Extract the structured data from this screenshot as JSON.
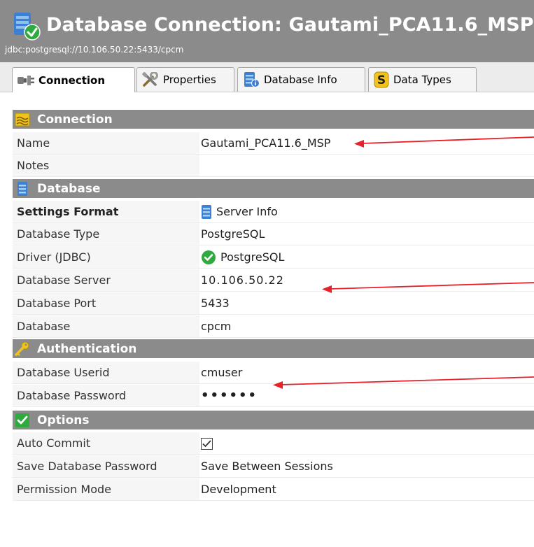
{
  "header": {
    "title": "Database Connection: Gautami_PCA11.6_MSP",
    "url": "jdbc:postgresql://10.106.50.22:5433/cpcm",
    "icon": "database-check-icon"
  },
  "tabs": [
    {
      "label": "Connection",
      "icon": "plug-icon",
      "active": true
    },
    {
      "label": "Properties",
      "icon": "tools-icon",
      "active": false
    },
    {
      "label": "Database Info",
      "icon": "database-icon",
      "active": false
    },
    {
      "label": "Data Types",
      "icon": "dollar-icon",
      "active": false
    }
  ],
  "sections": {
    "connection": {
      "title": "Connection",
      "icon": "connection-icon"
    },
    "database": {
      "title": "Database",
      "icon": "database-icon"
    },
    "authentication": {
      "title": "Authentication",
      "icon": "key-icon"
    },
    "options": {
      "title": "Options",
      "icon": "check-icon"
    }
  },
  "fields": {
    "name": {
      "label": "Name",
      "value": "Gautami_PCA11.6_MSP"
    },
    "notes": {
      "label": "Notes",
      "value": ""
    },
    "settings_format": {
      "label": "Settings Format",
      "value": "Server Info",
      "icon": "server-info-icon"
    },
    "database_type": {
      "label": "Database Type",
      "value": "PostgreSQL"
    },
    "driver": {
      "label": "Driver (JDBC)",
      "value": "PostgreSQL",
      "icon": "green-check-icon"
    },
    "database_server": {
      "label": "Database Server",
      "value": "10.106.50.22"
    },
    "database_port": {
      "label": "Database Port",
      "value": "5433"
    },
    "database": {
      "label": "Database",
      "value": "cpcm"
    },
    "userid": {
      "label": "Database Userid",
      "value": "cmuser"
    },
    "password": {
      "label": "Database Password",
      "value": "••••••"
    },
    "auto_commit": {
      "label": "Auto Commit",
      "checked": true
    },
    "save_password": {
      "label": "Save Database Password",
      "value": "Save Between Sessions"
    },
    "permission_mode": {
      "label": "Permission Mode",
      "value": "Development"
    }
  },
  "colors": {
    "header_bg": "#8b8b8b",
    "section_bg": "#8b8b8b",
    "annotation_arrow": "#e8202a",
    "check_green": "#2faa3f"
  }
}
